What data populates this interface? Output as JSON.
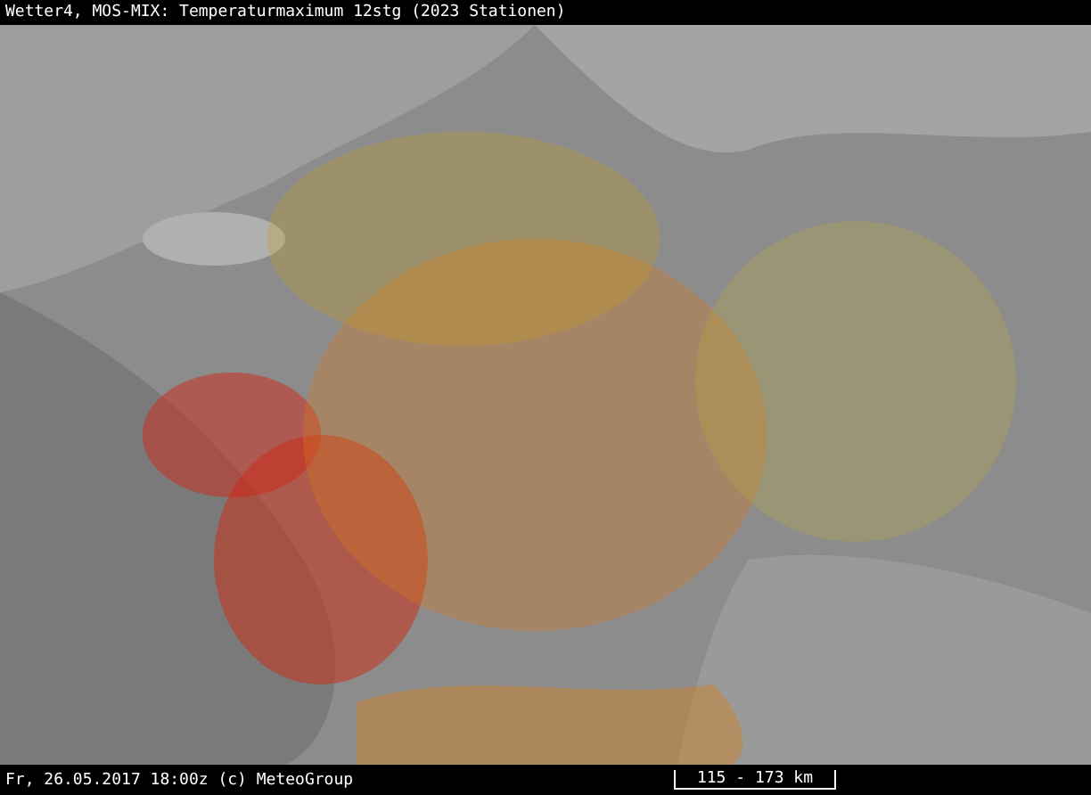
{
  "title": "Wetter4, MOS-MIX: Temperaturmaximum 12stg (2023 Stationen)",
  "footer": {
    "text": "Fr, 26.05.2017 18:00z (c) MeteoGroup",
    "scale": "115 - 173 km"
  }
}
